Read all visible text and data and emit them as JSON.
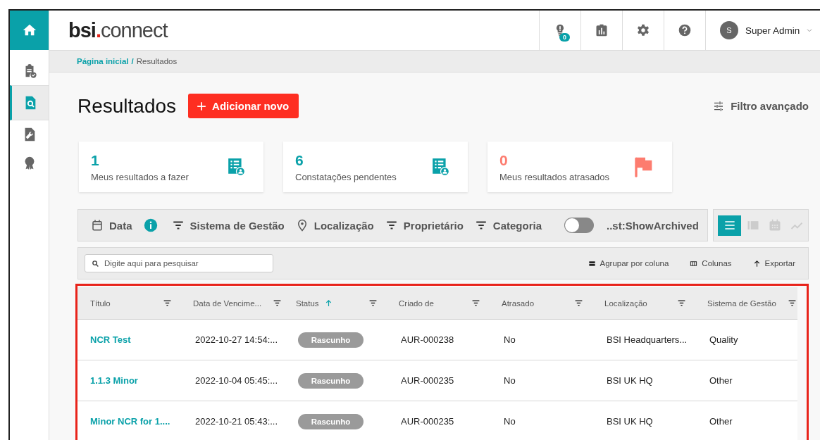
{
  "sidebar": {
    "items": [
      {
        "kind": "home",
        "selected": false
      },
      {
        "kind": "clipboard",
        "selected": false
      },
      {
        "kind": "search-doc",
        "selected": true
      },
      {
        "kind": "wrench-doc",
        "selected": false
      },
      {
        "kind": "award",
        "selected": false
      }
    ]
  },
  "header": {
    "logo": {
      "bold": "bsi",
      "dot": ".",
      "light": "connect"
    },
    "actions": [
      {
        "kind": "alerts",
        "badge": "0"
      },
      {
        "kind": "reports"
      },
      {
        "kind": "settings"
      },
      {
        "kind": "help"
      }
    ],
    "user": {
      "initial": "S",
      "name": "Super Admin"
    }
  },
  "breadcrumb": {
    "separator": "/",
    "items": [
      {
        "label": "Página inicial",
        "link": true
      },
      {
        "label": "Resultados",
        "link": false
      }
    ]
  },
  "page": {
    "title": "Resultados",
    "add_button": "Adicionar novo",
    "advanced_filter": "Filtro avançado"
  },
  "summary_cards": [
    {
      "value": "1",
      "label": "Meus resultados a fazer",
      "color": "#0aa1a9",
      "kind": "list"
    },
    {
      "value": "6",
      "label": "Constatações pendentes",
      "color": "#0aa1a9",
      "kind": "list"
    },
    {
      "value": "0",
      "label": "Meus resultados atrasados",
      "color": "#fd7c6f",
      "kind": "flag"
    }
  ],
  "filters": [
    {
      "kind": "date",
      "label": "Data",
      "info": true
    },
    {
      "kind": "filter",
      "label": "Sistema de Gestão"
    },
    {
      "kind": "location",
      "label": "Localização"
    },
    {
      "kind": "filter",
      "label": "Proprietário"
    },
    {
      "kind": "filter",
      "label": "Categoria"
    },
    {
      "kind": "toggle",
      "label": "..st:ShowArchived",
      "on": false
    }
  ],
  "view_modes": [
    {
      "kind": "list",
      "selected": true
    },
    {
      "kind": "board",
      "selected": false
    },
    {
      "kind": "calendar",
      "selected": false
    },
    {
      "kind": "chart",
      "selected": false
    }
  ],
  "toolbar": {
    "search": {
      "placeholder": "Digite aqui para pesquisar"
    },
    "actions": [
      {
        "kind": "group",
        "label": "Agrupar por coluna"
      },
      {
        "kind": "columns",
        "label": "Colunas"
      },
      {
        "kind": "export",
        "label": "Exportar"
      }
    ]
  },
  "table": {
    "columns": [
      {
        "label": "Título",
        "kind": "link",
        "sorted": false
      },
      {
        "label": "Data de Vencime...",
        "kind": "text",
        "sorted": false
      },
      {
        "label": "Status",
        "kind": "badge",
        "sorted": true
      },
      {
        "label": "Criado de",
        "kind": "text",
        "sorted": false
      },
      {
        "label": "Atrasado",
        "kind": "text",
        "sorted": false
      },
      {
        "label": "Localização",
        "kind": "text",
        "sorted": false
      },
      {
        "label": "Sistema de Gestão",
        "kind": "text",
        "sorted": false
      }
    ],
    "rows": [
      [
        "NCR Test",
        "2022-10-27 14:54:...",
        "Rascunho",
        "AUR-000238",
        "No",
        "BSI Headquarters...",
        "Quality"
      ],
      [
        "1.1.3 Minor",
        "2022-10-04 05:45:...",
        "Rascunho",
        "AUR-000235",
        "No",
        "BSI UK HQ",
        "Other"
      ],
      [
        "Minor NCR for 1....",
        "2022-10-21 05:43:...",
        "Rascunho",
        "AUR-000235",
        "No",
        "BSI UK HQ",
        "Other"
      ]
    ]
  }
}
